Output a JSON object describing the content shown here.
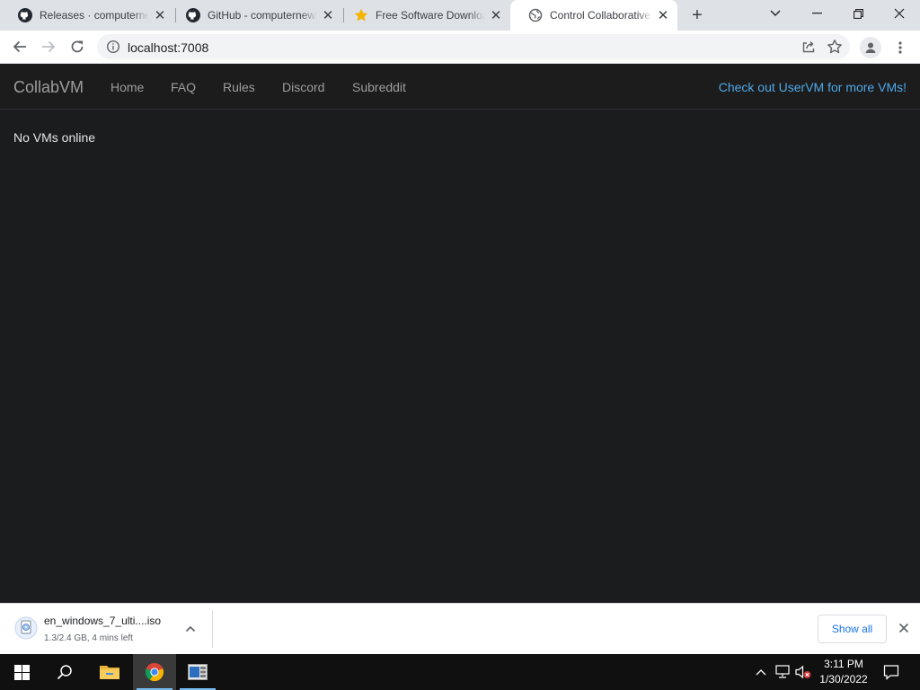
{
  "browser": {
    "tabs": [
      {
        "title": "Releases · computernewb/collab-vm-server",
        "icon": "github-icon",
        "active": false
      },
      {
        "title": "GitHub - computernewb/collab-vm-web-app",
        "icon": "github-icon",
        "active": false
      },
      {
        "title": "Free Software Download",
        "icon": "star-icon",
        "active": false
      },
      {
        "title": "Control Collaborative Virtual Machines!",
        "icon": "globe-icon",
        "active": true
      }
    ],
    "address": "localhost:7008"
  },
  "site": {
    "brand": "CollabVM",
    "nav": [
      "Home",
      "FAQ",
      "Rules",
      "Discord",
      "Subreddit"
    ],
    "promo": "Check out UserVM for more VMs!",
    "empty_message": "No VMs online"
  },
  "download": {
    "filename": "en_windows_7_ulti....iso",
    "status": "1.3/2.4 GB, 4 mins left",
    "show_all": "Show all"
  },
  "taskbar": {
    "time": "3:11 PM",
    "date": "1/30/2022"
  },
  "colors": {
    "page_bg": "#1b1c1d",
    "link_accent": "#4fa8e8",
    "chrome_blue": "#1a73e8"
  }
}
